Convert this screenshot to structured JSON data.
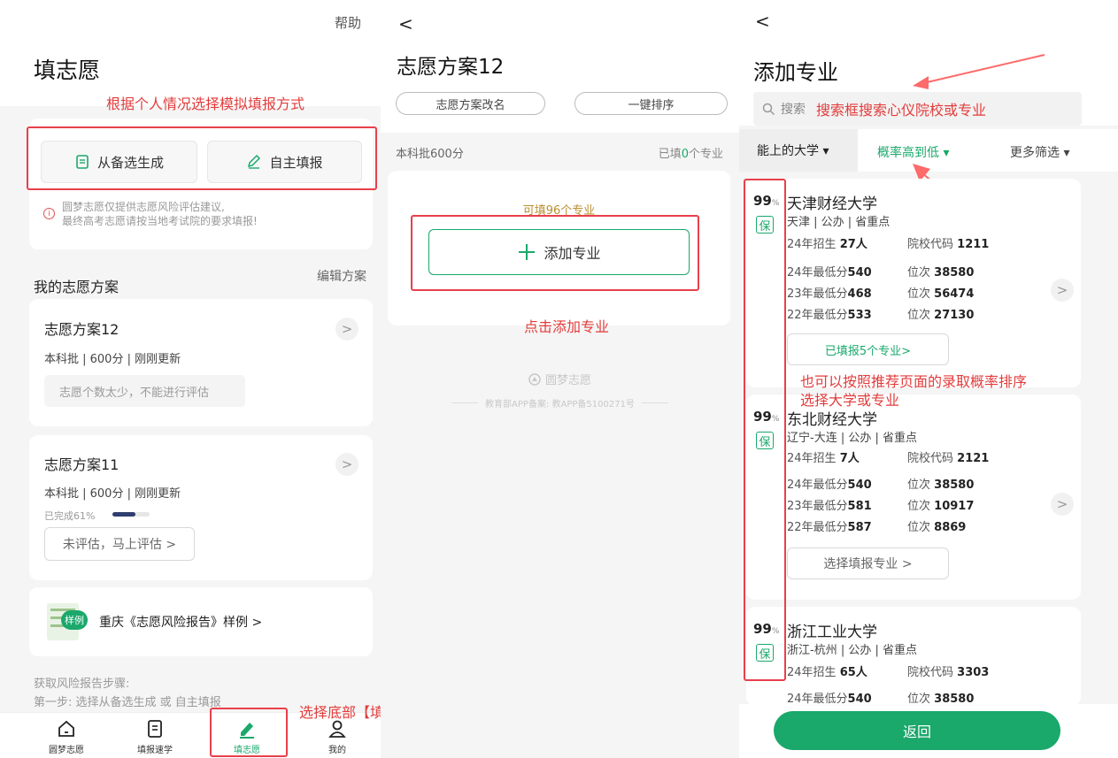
{
  "panel1": {
    "help": "帮助",
    "title": "填志愿",
    "ann_choose_mode": "根据个人情况选择模拟填报方式",
    "btn_generate": "从备选生成",
    "btn_manual": "自主填报",
    "notice_line1": "圆梦志愿仅提供志愿风险评估建议,",
    "notice_line2": "最终高考志愿请按当地考试院的要求填报!",
    "my_plans": "我的志愿方案",
    "edit_plans": "编辑方案",
    "plan12": {
      "name": "志愿方案12",
      "meta": "本科批 | 600分 | 刚刚更新",
      "note": "志愿个数太少，不能进行评估"
    },
    "plan11": {
      "name": "志愿方案11",
      "meta": "本科批 | 600分 | 刚刚更新",
      "progress_label": "已完成61%",
      "progress": 0.61,
      "eval_button": "未评估，马上评估 >"
    },
    "sample_badge": "样例",
    "sample_text": "重庆《志愿风险报告》样例 >",
    "steps_title": "获取风险报告步骤:",
    "steps_line1": "第一步: 选择从备选生成 或 自主填报",
    "ann_bottom": "选择底部【填志愿】项",
    "nav": [
      {
        "label": "圆梦志愿"
      },
      {
        "label": "填报速学"
      },
      {
        "label": "填志愿"
      },
      {
        "label": "我的"
      }
    ]
  },
  "panel2": {
    "back": "<",
    "title": "志愿方案12",
    "btn_rename": "志愿方案改名",
    "btn_sort": "一键排序",
    "batch": "本科批600分",
    "filled_prefix": "已填",
    "filled_count": "0",
    "filled_suffix": "个专业",
    "can_fill": "可填96个专业",
    "add_major": "添加专业",
    "ann_click_add": "点击添加专业",
    "brand": "圆梦志愿",
    "footer": "教育部APP备案: 教APP备5100271号"
  },
  "panel3": {
    "back": "<",
    "title": "添加专业",
    "search_placeholder": "搜索",
    "ann_search": "搜索框搜索心仪院校或专业",
    "filter_reach": "能上的大学 ▾",
    "filter_prob": "概率高到低 ▾",
    "filter_more": "更多筛选 ▾",
    "ann_sort_line1": "也可以按照推荐页面的录取概率排序",
    "ann_sort_line2": "选择大学或专业",
    "back_button": "返回",
    "unis": [
      {
        "pct": "99",
        "pct_unit": "%",
        "tag": "保",
        "name": "天津财经大学",
        "loc": "天津 | 公办 | 省重点",
        "enroll_label": "24年招生",
        "enroll": "27人",
        "code_label": "院校代码",
        "code": "1211",
        "rows": [
          {
            "year": "24年最低分",
            "score": "540",
            "rank_label": "位次",
            "rank": "38580"
          },
          {
            "year": "23年最低分",
            "score": "468",
            "rank_label": "位次",
            "rank": "56474"
          },
          {
            "year": "22年最低分",
            "score": "533",
            "rank_label": "位次",
            "rank": "27130"
          }
        ],
        "action": "已填报5个专业>"
      },
      {
        "pct": "99",
        "pct_unit": "%",
        "tag": "保",
        "name": "东北财经大学",
        "loc": "辽宁-大连 | 公办 | 省重点",
        "enroll_label": "24年招生",
        "enroll": "7人",
        "code_label": "院校代码",
        "code": "2121",
        "rows": [
          {
            "year": "24年最低分",
            "score": "540",
            "rank_label": "位次",
            "rank": "38580"
          },
          {
            "year": "23年最低分",
            "score": "581",
            "rank_label": "位次",
            "rank": "10917"
          },
          {
            "year": "22年最低分",
            "score": "587",
            "rank_label": "位次",
            "rank": "8869"
          }
        ],
        "action": "选择填报专业 >"
      },
      {
        "pct": "99",
        "pct_unit": "%",
        "tag": "保",
        "name": "浙江工业大学",
        "loc": "浙江-杭州 | 公办 | 省重点",
        "enroll_label": "24年招生",
        "enroll": "65人",
        "code_label": "院校代码",
        "code": "3303",
        "rows": [
          {
            "year": "24年最低分",
            "score": "540",
            "rank_label": "位次",
            "rank": "38580"
          }
        ]
      }
    ]
  },
  "colors": {
    "green": "#1aa86b",
    "annotation_red": "#e23c3c",
    "gold": "#b9902f"
  }
}
